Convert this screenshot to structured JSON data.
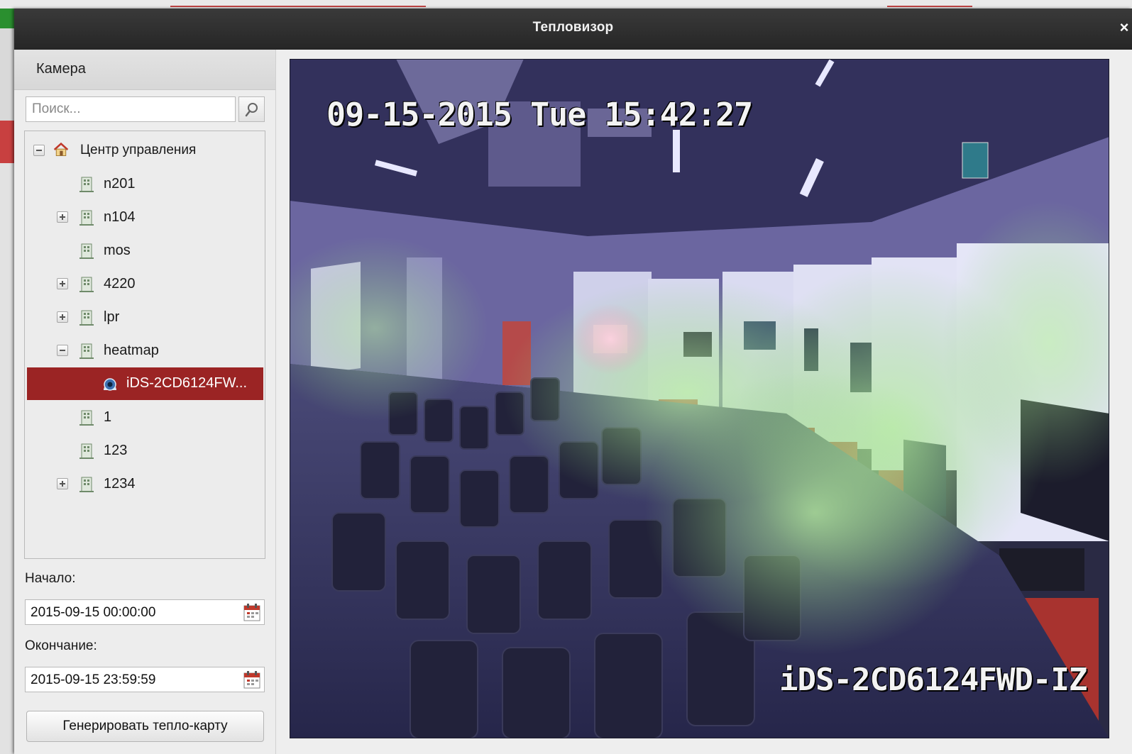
{
  "dialog": {
    "title": "Тепловизор",
    "close_label": "×"
  },
  "camera_panel": {
    "header": "Камера",
    "search_placeholder": "Поиск..."
  },
  "tree": {
    "root": {
      "label": "Центр управления",
      "state": "expanded"
    },
    "items": [
      {
        "label": "n201",
        "expander": "none"
      },
      {
        "label": "n104",
        "expander": "plus"
      },
      {
        "label": "mos",
        "expander": "none"
      },
      {
        "label": "4220",
        "expander": "plus"
      },
      {
        "label": "lpr",
        "expander": "plus"
      },
      {
        "label": "heatmap",
        "expander": "minus"
      },
      {
        "label": "iDS-2CD6124FW...",
        "expander": "none",
        "type": "camera",
        "selected": true
      },
      {
        "label": "1",
        "expander": "none"
      },
      {
        "label": "123",
        "expander": "none"
      },
      {
        "label": "1234",
        "expander": "plus"
      }
    ]
  },
  "time_range": {
    "start_label": "Начало:",
    "start_value": "2015-09-15 00:00:00",
    "end_label": "Окончание:",
    "end_value": "2015-09-15 23:59:59"
  },
  "generate_button": "Генерировать тепло-карту",
  "video": {
    "osd_timestamp": "09-15-2015 Tue 15:42:27",
    "osd_camera_name": "iDS-2CD6124FWD-IZ"
  },
  "colors": {
    "titlebar": "#2e2e2e",
    "selection": "#9b2424",
    "heatmap_cold": "#5a4fa8",
    "heatmap_warm": "#8fd47a",
    "heatmap_hot": "#f0c8c8"
  }
}
